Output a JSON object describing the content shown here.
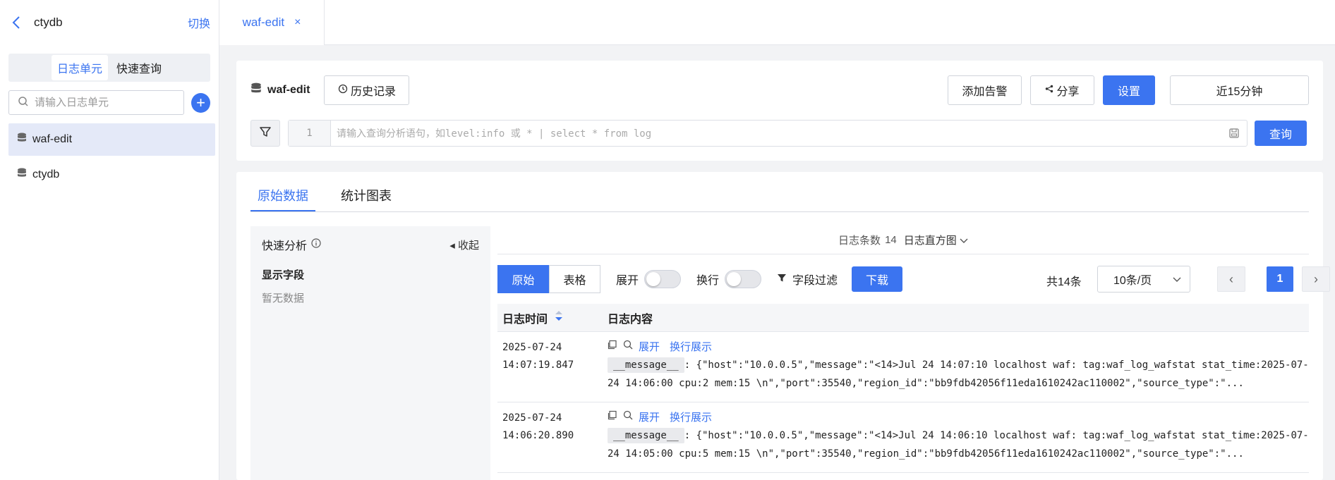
{
  "sidebar": {
    "title": "ctydb",
    "switch_label": "切换",
    "tabs": [
      {
        "label": "日志单元",
        "active": true
      },
      {
        "label": "快速查询",
        "active": false
      }
    ],
    "search_placeholder": "请输入日志单元",
    "items": [
      {
        "label": "waf-edit",
        "selected": true
      },
      {
        "label": "ctydb",
        "selected": false
      }
    ]
  },
  "top_tab": {
    "label": "waf-edit",
    "close": "×"
  },
  "query": {
    "logunit": "waf-edit",
    "history_label": "历史记录",
    "alert_label": "添加告警",
    "share_label": "分享",
    "settings_label": "设置",
    "time_range": "近15分钟",
    "line_number": "1",
    "placeholder": "请输入查询分析语句，如level:info 或 * | select * from log",
    "search_label": "查询"
  },
  "results": {
    "tabs": [
      "原始数据",
      "统计图表"
    ],
    "active_tab": 0,
    "quick_analysis": {
      "title": "快速分析",
      "collapse_label": "收起",
      "fields_title": "显示字段",
      "empty": "暂无数据"
    },
    "histogram": {
      "count_label": "日志条数",
      "count": "14",
      "toggle_label": "日志直方图"
    },
    "toolbar": {
      "view_raw": "原始",
      "view_table": "表格",
      "expand_label": "展开",
      "wrap_label": "换行",
      "field_filter": "字段过滤",
      "download": "下载"
    },
    "pagination": {
      "total": "共14条",
      "page_size": "10条/页",
      "current": "1"
    },
    "columns": [
      "日志时间",
      "日志内容"
    ],
    "row_actions": {
      "expand": "展开",
      "wrap": "换行展示"
    },
    "field_tag": "__message__",
    "rows": [
      {
        "date": "2025-07-24",
        "time": "14:07:19.847",
        "message": ": {\"host\":\"10.0.0.5\",\"message\":\"<14>Jul 24 14:07:10 localhost waf: tag:waf_log_wafstat  stat_time:2025-07-24 14:06:00  cpu:2  mem:15 \\n\",\"port\":35540,\"region_id\":\"bb9fdb42056f11eda1610242ac110002\",\"source_type\":\"..."
      },
      {
        "date": "2025-07-24",
        "time": "14:06:20.890",
        "message": ": {\"host\":\"10.0.0.5\",\"message\":\"<14>Jul 24 14:06:10 localhost waf: tag:waf_log_wafstat  stat_time:2025-07-24 14:05:00  cpu:5  mem:15 \\n\",\"port\":35540,\"region_id\":\"bb9fdb42056f11eda1610242ac110002\",\"source_type\":\"..."
      }
    ]
  }
}
